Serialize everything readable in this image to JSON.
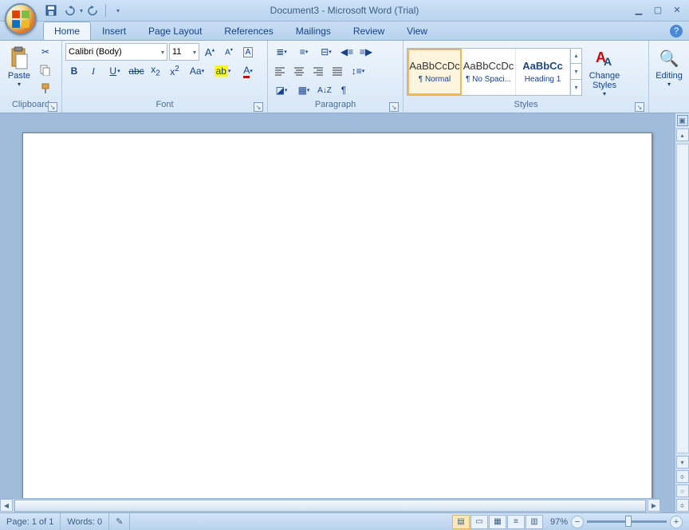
{
  "title": "Document3 - Microsoft Word (Trial)",
  "qat": {
    "customize_tip": "▾"
  },
  "tabs": [
    {
      "label": "Home",
      "active": true
    },
    {
      "label": "Insert",
      "active": false
    },
    {
      "label": "Page Layout",
      "active": false
    },
    {
      "label": "References",
      "active": false
    },
    {
      "label": "Mailings",
      "active": false
    },
    {
      "label": "Review",
      "active": false
    },
    {
      "label": "View",
      "active": false
    }
  ],
  "ribbon": {
    "clipboard": {
      "label": "Clipboard",
      "paste": "Paste"
    },
    "font": {
      "label": "Font",
      "family": "Calibri (Body)",
      "size": "11"
    },
    "paragraph": {
      "label": "Paragraph"
    },
    "styles": {
      "label": "Styles",
      "items": [
        {
          "preview": "AaBbCcDc",
          "name": "¶ Normal",
          "selected": true
        },
        {
          "preview": "AaBbCcDc",
          "name": "¶ No Spaci...",
          "selected": false
        },
        {
          "preview": "AaBbCc",
          "name": "Heading 1",
          "selected": false
        }
      ],
      "change": "Change Styles"
    },
    "editing": {
      "label": "Editing"
    }
  },
  "status": {
    "page": "Page: 1 of 1",
    "words": "Words: 0",
    "zoom": "97%"
  }
}
